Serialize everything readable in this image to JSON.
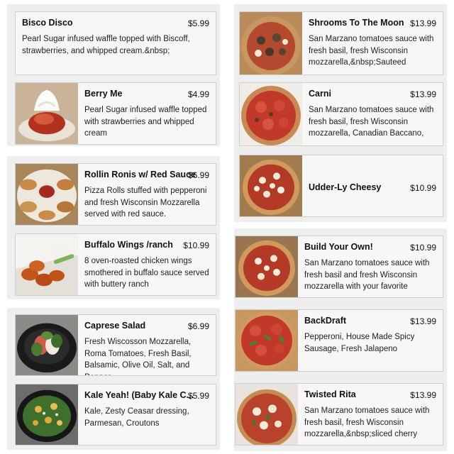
{
  "menu": {
    "bisco_disco": {
      "title": "Bisco Disco",
      "price": "$5.99",
      "description": "Pearl Sugar infused waffle topped with Biscoff, strawberries, and whipped cream.&nbsp;"
    },
    "berry_me": {
      "title": "Berry Me",
      "price": "$4.99",
      "description": "Pearl Sugar infused waffle topped with strawberries and whipped cream"
    },
    "rollin_ronis": {
      "title": "Rollin Ronis w/ Red Sauce",
      "price": "$6.99",
      "description": "Pizza Rolls stuffed with pepperoni and fresh Wisconsin Mozzarella served with red sauce."
    },
    "buffalo_wings": {
      "title": "Buffalo Wings /ranch",
      "price": "$10.99",
      "description": "8 oven-roasted chicken wings smothered in buffalo sauce served with buttery ranch"
    },
    "caprese_salad": {
      "title": "Caprese Salad",
      "price": "$6.99",
      "description": "Fresh Wiscosson Mozzarella, Roma Tomatoes, Fresh Basil, Balsamic, Olive Oil, Salt, and Pepper"
    },
    "kale_yeah": {
      "title": "Kale Yeah! (Baby Kale C...",
      "price": "$5.99",
      "description": "Kale, Zesty Ceasar dressing, Parmesan, Croutons"
    },
    "shrooms_to_the_moon": {
      "title": "Shrooms To The Moon",
      "price": "$13.99",
      "description": "San Marzano tomatoes sauce with fresh basil, fresh Wisconsin mozzarella,&nbsp;Sauteed"
    },
    "carni": {
      "title": "Carni",
      "price": "$13.99",
      "description": "San Marzano tomatoes sauce with fresh basil, fresh Wisconsin mozzarella, Canadian Baccano,"
    },
    "udder_ly_cheesy": {
      "title": "Udder-Ly Cheesy",
      "price": "$10.99",
      "description": ""
    },
    "build_your_own": {
      "title": "Build Your Own!",
      "price": "$10.99",
      "description": "San Marzano tomatoes sauce with fresh basil and fresh Wisconsin mozzarella with your favorite"
    },
    "backdraft": {
      "title": "BackDraft",
      "price": "$13.99",
      "description": "Pepperoni, House Made Spicy Sausage, Fresh Jalapeno"
    },
    "twisted_rita": {
      "title": "Twisted Rita",
      "price": "$13.99",
      "description": "San Marzano tomatoes sauce with fresh basil, fresh Wisconsin mozzarella,&nbsp;sliced cherry"
    }
  }
}
